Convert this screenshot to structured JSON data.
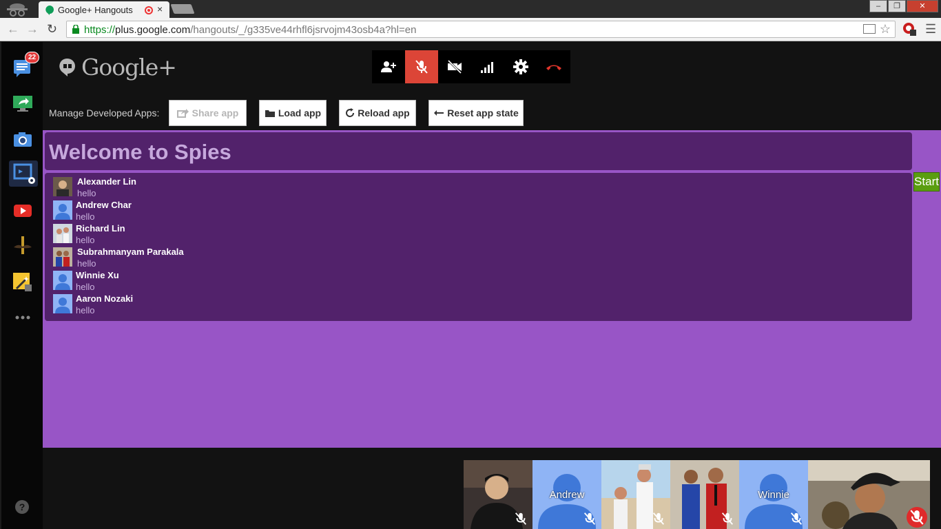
{
  "browser": {
    "tab_title": "Google+ Hangouts",
    "close_tab": "×",
    "url_https": "https://",
    "url_host": "plus.google.com",
    "url_path": "/hangouts/_/g335ve44rhfl6jsrvojm43osb4a?hl=en",
    "window_buttons": [
      "–",
      "❐",
      "✕"
    ]
  },
  "rail": {
    "notification_count": "22",
    "items": [
      "hangout-chat-icon",
      "screenshare-icon",
      "camera-icon",
      "app-developer-icon",
      "youtube-icon",
      "mustache-icon",
      "effects-icon",
      "more-icon"
    ],
    "help": "?"
  },
  "header": {
    "brand": "Google+"
  },
  "controls": [
    "invite-people-icon",
    "mute-mic-icon",
    "turn-off-camera-icon",
    "bandwidth-icon",
    "settings-icon",
    "leave-call-icon"
  ],
  "dev_apps": {
    "label": "Manage Developed Apps:",
    "share": "Share app",
    "load": "Load app",
    "reload": "Reload app",
    "reset": "Reset app state"
  },
  "app": {
    "title": "Welcome to Spies",
    "start_label": "Start",
    "players": [
      {
        "name": "Alexander Lin",
        "message": "hello",
        "avatar": "photo"
      },
      {
        "name": "Andrew Char",
        "message": "hello",
        "avatar": "default"
      },
      {
        "name": "Richard Lin",
        "message": "hello",
        "avatar": "photo"
      },
      {
        "name": "Subrahmanyam Parakala",
        "message": "hello",
        "avatar": "photo"
      },
      {
        "name": "Winnie Xu",
        "message": "hello",
        "avatar": "default"
      },
      {
        "name": "Aaron Nozaki",
        "message": "hello",
        "avatar": "default"
      }
    ]
  },
  "filmstrip": [
    {
      "label": "",
      "type": "photo"
    },
    {
      "label": "Andrew",
      "type": "default"
    },
    {
      "label": "",
      "type": "photo"
    },
    {
      "label": "",
      "type": "photo"
    },
    {
      "label": "Winnie",
      "type": "default"
    },
    {
      "label": "",
      "type": "photo"
    }
  ],
  "colors": {
    "app_background": "#9855c6",
    "panel": "#52226b",
    "start_button": "#5a9e10",
    "mute_active": "#dc4537"
  }
}
